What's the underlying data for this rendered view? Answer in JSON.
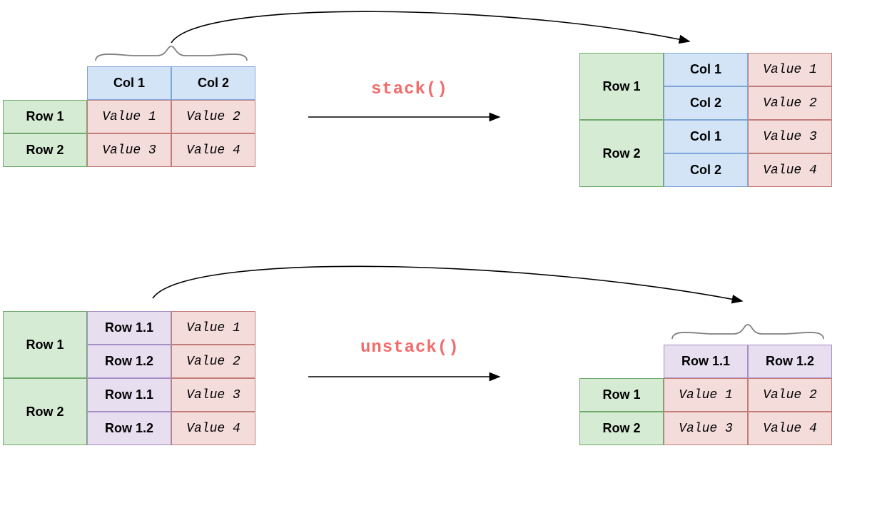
{
  "functions": {
    "stack": "stack()",
    "unstack": "unstack()"
  },
  "labels": {
    "row1": "Row 1",
    "row2": "Row 2",
    "col1": "Col 1",
    "col2": "Col 2",
    "row11": "Row 1.1",
    "row12": "Row 1.2",
    "v1": "Value 1",
    "v2": "Value 2",
    "v3": "Value 3",
    "v4": "Value 4"
  },
  "colors": {
    "green_fill": "#d6ebd4",
    "green_border": "#6fab6c",
    "blue_fill": "#d4e4f7",
    "blue_border": "#7fa6d9",
    "red_fill": "#f4dcdb",
    "red_border": "#c27d7a",
    "purple_fill": "#e7dff0",
    "purple_border": "#a58fc5",
    "function_text": "#f26b6b"
  },
  "diagram": {
    "description": "Two data-frame reshaping diagrams. Top: stack() converts a 2x2 DataFrame (Row1/Row2 x Col1/Col2) into a multi-index Series where column labels become a second-level row index. Bottom: unstack() converts a multi-index Series (Row1/Row2 x Row1.1/Row1.2) back into a 2x2 DataFrame where the inner index level becomes column labels."
  },
  "tables": {
    "stack_input": {
      "columns": [
        "Col 1",
        "Col 2"
      ],
      "rows": [
        "Row 1",
        "Row 2"
      ],
      "data": [
        [
          "Value 1",
          "Value 2"
        ],
        [
          "Value 3",
          "Value 4"
        ]
      ]
    },
    "stack_output": {
      "outer_rows": [
        "Row 1",
        "Row 2"
      ],
      "inner_rows": [
        "Col 1",
        "Col 2"
      ],
      "values": [
        "Value 1",
        "Value 2",
        "Value 3",
        "Value 4"
      ],
      "inner_color": "blue"
    },
    "unstack_input": {
      "outer_rows": [
        "Row 1",
        "Row 2"
      ],
      "inner_rows": [
        "Row 1.1",
        "Row 1.2"
      ],
      "values": [
        "Value 1",
        "Value 2",
        "Value 3",
        "Value 4"
      ],
      "inner_color": "purple"
    },
    "unstack_output": {
      "columns": [
        "Row 1.1",
        "Row 1.2"
      ],
      "rows": [
        "Row 1",
        "Row 2"
      ],
      "data": [
        [
          "Value 1",
          "Value 2"
        ],
        [
          "Value 3",
          "Value 4"
        ]
      ],
      "column_color": "purple"
    }
  }
}
